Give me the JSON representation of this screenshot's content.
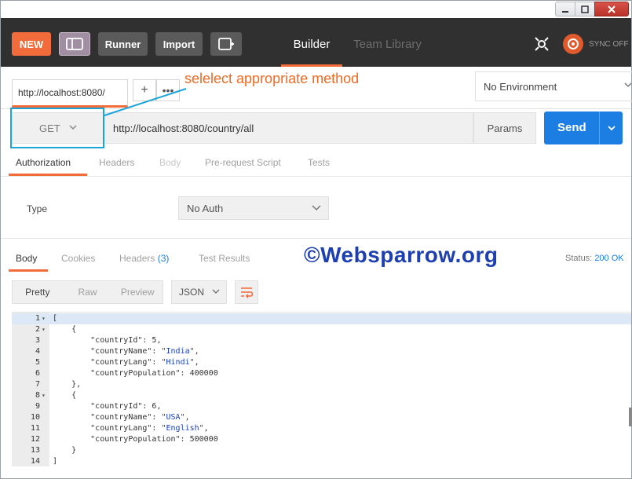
{
  "header": {
    "new_label": "NEW",
    "runner_label": "Runner",
    "import_label": "Import",
    "tabs": [
      {
        "label": "Builder"
      },
      {
        "label": "Team Library"
      }
    ],
    "sync_label": "SYNC OFF"
  },
  "request_tabs": {
    "active_tab": "http://localhost:8080/",
    "plus": "+",
    "more": "•••"
  },
  "environment": {
    "selected": "No Environment"
  },
  "request": {
    "method": "GET",
    "url": "http://localhost:8080/country/all",
    "params_label": "Params",
    "send_label": "Send"
  },
  "annotation": {
    "text": "selelect appropriate method",
    "box_color": "#1ea5d8",
    "text_color": "#f06a22"
  },
  "request_subtabs": [
    {
      "label": "Authorization"
    },
    {
      "label": "Headers"
    },
    {
      "label": "Body"
    },
    {
      "label": "Pre-request Script"
    },
    {
      "label": "Tests"
    }
  ],
  "auth": {
    "type_label": "Type",
    "selected": "No Auth"
  },
  "response": {
    "tabs": {
      "body": "Body",
      "cookies": "Cookies",
      "headers": "Headers",
      "headers_count": "(3)",
      "test_results": "Test Results"
    },
    "status_label": "Status:",
    "status_value": "200 OK",
    "watermark": "©Websparrow.org",
    "view_options": [
      "Pretty",
      "Raw",
      "Preview"
    ],
    "format": "JSON"
  },
  "code_lines": [
    {
      "n": "1",
      "fold": "▾",
      "text": "["
    },
    {
      "n": "2",
      "fold": "▾",
      "text": "    {"
    },
    {
      "n": "3",
      "fold": "",
      "text": "        \"countryId\": 5,"
    },
    {
      "n": "4",
      "fold": "",
      "text": "        \"countryName\": \"India\","
    },
    {
      "n": "5",
      "fold": "",
      "text": "        \"countryLang\": \"Hindi\","
    },
    {
      "n": "6",
      "fold": "",
      "text": "        \"countryPopulation\": 400000"
    },
    {
      "n": "7",
      "fold": "",
      "text": "    },"
    },
    {
      "n": "8",
      "fold": "▾",
      "text": "    {"
    },
    {
      "n": "9",
      "fold": "",
      "text": "        \"countryId\": 6,"
    },
    {
      "n": "10",
      "fold": "",
      "text": "        \"countryName\": \"USA\","
    },
    {
      "n": "11",
      "fold": "",
      "text": "        \"countryLang\": \"English\","
    },
    {
      "n": "12",
      "fold": "",
      "text": "        \"countryPopulation\": 500000"
    },
    {
      "n": "13",
      "fold": "",
      "text": "    }"
    },
    {
      "n": "14",
      "fold": "",
      "text": "]"
    }
  ],
  "colors": {
    "accent": "#f26b3a",
    "primary": "#1c7ee2",
    "header_bg": "#303030"
  }
}
